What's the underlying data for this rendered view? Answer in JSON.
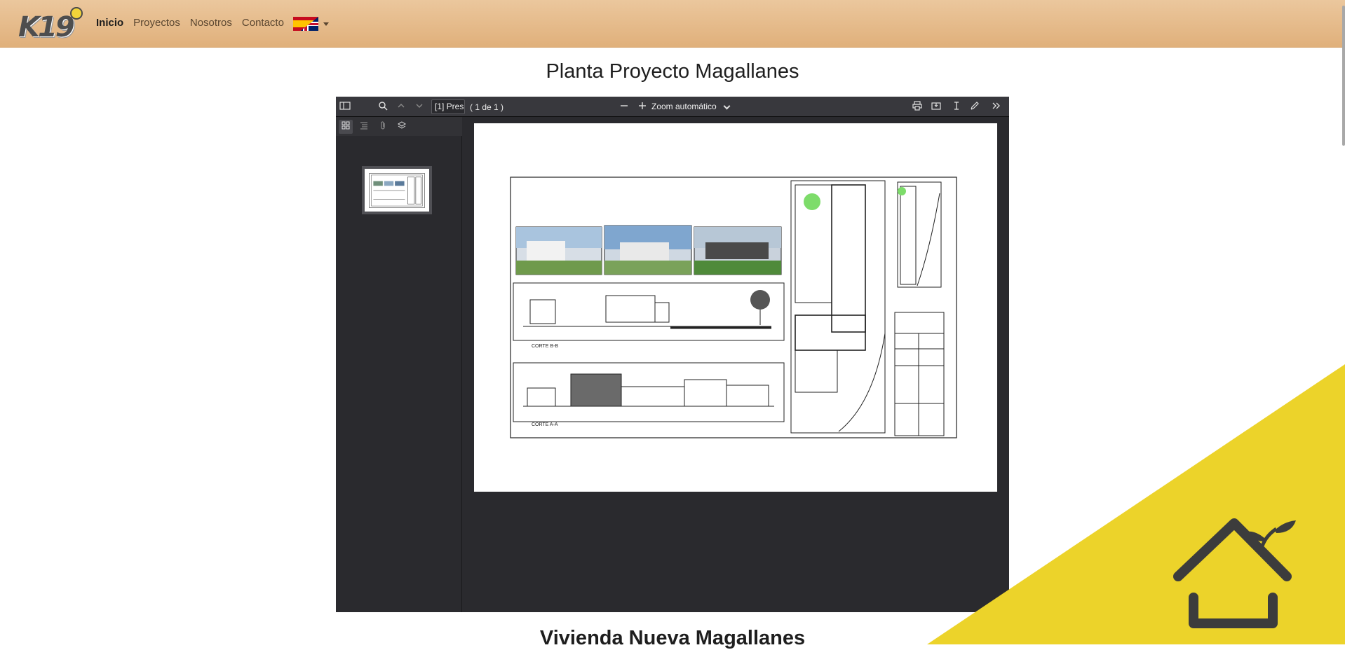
{
  "nav": {
    "logo_text": "K19",
    "links": [
      {
        "label": "Inicio",
        "active": true
      },
      {
        "label": "Proyectos",
        "active": false
      },
      {
        "label": "Nosotros",
        "active": false
      },
      {
        "label": "Contacto",
        "active": false
      }
    ]
  },
  "heading": "Planta Proyecto Magallanes",
  "heading_next": "Vivienda Nueva Magallanes",
  "viewer": {
    "page_input": "[1] Pres",
    "page_count": "( 1 de 1 )",
    "zoom": "Zoom automático",
    "drawing_labels": {
      "section_b": "CORTE B-B",
      "section_a": "CORTE A-A"
    }
  },
  "colors": {
    "navbar": "#e4b985",
    "viewer_bg": "#2a2a2e",
    "toolbar": "#38383d",
    "accent_yellow": "#ecd32a",
    "house_icon": "#3c3c3c"
  },
  "icons": {
    "sidebar_toggle": "sidebar-toggle-icon",
    "search": "search-icon",
    "prev": "chevron-up-icon",
    "next": "chevron-down-icon",
    "zoom_out": "minus-icon",
    "zoom_in": "plus-icon",
    "print": "print-icon",
    "save": "download-icon",
    "text": "text-cursor-icon",
    "draw": "pen-icon",
    "more": "double-chevron-right-icon"
  }
}
